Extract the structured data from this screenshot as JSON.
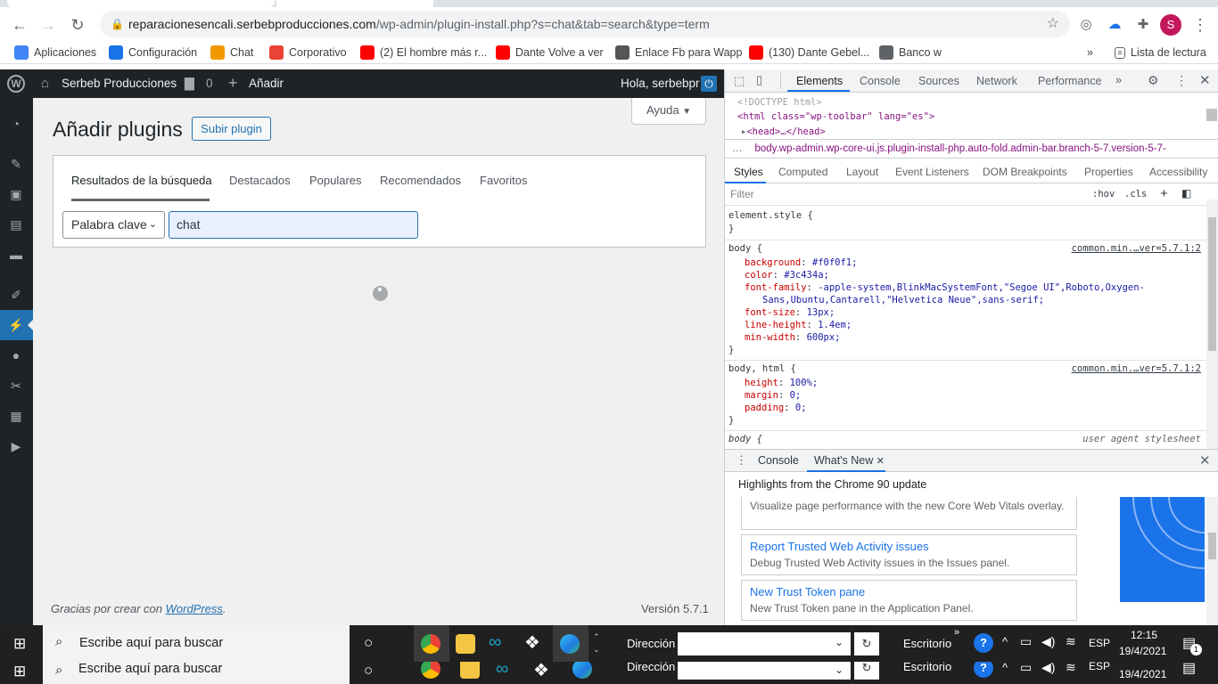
{
  "browser": {
    "url_host": "reparacionesencali.serbebproducciones.com",
    "url_path": "/wp-admin/plugin-install.php?s=chat&tab=search&type=term",
    "profile_initial": "S",
    "bookmarks": [
      {
        "label": "Aplicaciones",
        "icon": "apps-grid-icon",
        "color": "#4285f4"
      },
      {
        "label": "Configuración",
        "icon": "gear-icon",
        "color": "#1a73e8"
      },
      {
        "label": "Chat",
        "icon": "chat-icon",
        "color": "#f29900"
      },
      {
        "label": "Corporativo",
        "icon": "gmail-icon",
        "color": "#ea4335"
      },
      {
        "label": "(2) El hombre más r...",
        "icon": "youtube-icon",
        "color": "#ff0000"
      },
      {
        "label": "Dante Volve a ver",
        "icon": "youtube-icon",
        "color": "#ff0000"
      },
      {
        "label": "Enlace Fb para Wapp",
        "icon": "avatar-icon",
        "color": "#555555"
      },
      {
        "label": "(130) Dante Gebel...",
        "icon": "youtube-icon",
        "color": "#ff0000"
      },
      {
        "label": "Banco w",
        "icon": "globe-icon",
        "color": "#5f6368"
      }
    ],
    "reading_list": "Lista de lectura",
    "overflow": "»"
  },
  "wp": {
    "site_name": "Serbeb Producciones",
    "comments_count": "0",
    "add_new": "Añadir",
    "greeting": "Hola, serbebpr",
    "page_title": "Añadir plugins",
    "upload_button": "Subir plugin",
    "help_button": "Ayuda",
    "tabs": [
      "Resultados de la búsqueda",
      "Destacados",
      "Populares",
      "Recomendados",
      "Favoritos"
    ],
    "search_type": "Palabra clave",
    "search_value": "chat",
    "footer_text": "Gracias por crear con",
    "footer_link": "WordPress",
    "footer_period": ".",
    "version": "Versión 5.7.1"
  },
  "devtools": {
    "main_tabs": [
      "Elements",
      "Console",
      "Sources",
      "Network",
      "Performance"
    ],
    "dom_lines": [
      "<!DOCTYPE html>",
      "<html class=\"wp-toolbar\" lang=\"es\">",
      "<head>…</head>"
    ],
    "breadcrumb": "body.wp-admin.wp-core-ui.js.plugin-install-php.auto-fold.admin-bar.branch-5-7.version-5-7-",
    "style_tabs": [
      "Styles",
      "Computed",
      "Layout",
      "Event Listeners",
      "DOM Breakpoints",
      "Properties",
      "Accessibility"
    ],
    "filter_placeholder": "Filter",
    "hov": ":hov",
    "cls": ".cls",
    "element_style": "element.style {",
    "rule1_selector": "body {",
    "rule1_source": "common.min.…ver=5.7.1:2",
    "rule1_props": [
      {
        "p": "background",
        "v": "#f0f0f1;"
      },
      {
        "p": "color",
        "v": "#3c434a;"
      },
      {
        "p": "font-family",
        "v": "-apple-system,BlinkMacSystemFont,\"Segoe UI\",Roboto,Oxygen-"
      },
      {
        "p": "",
        "v": "Sans,Ubuntu,Cantarell,\"Helvetica Neue\",sans-serif;"
      },
      {
        "p": "font-size",
        "v": "13px;"
      },
      {
        "p": "line-height",
        "v": "1.4em;"
      },
      {
        "p": "min-width",
        "v": "600px;"
      }
    ],
    "rule2_selector": "body, html {",
    "rule2_source": "common.min.…ver=5.7.1:2",
    "rule2_props": [
      {
        "p": "height",
        "v": "100%;"
      },
      {
        "p": "margin",
        "v": "0;"
      },
      {
        "p": "padding",
        "v": "0;"
      }
    ],
    "rule3_selector": "body {",
    "rule3_source": "user agent stylesheet",
    "close_brace": "}",
    "drawer_tabs": [
      "Console",
      "What's New"
    ],
    "whats_new_title": "Highlights from the Chrome 90 update",
    "cards": [
      {
        "title": "",
        "desc": "Visualize page performance with the new Core Web Vitals overlay."
      },
      {
        "title": "Report Trusted Web Activity issues",
        "desc": "Debug Trusted Web Activity issues in the Issues panel."
      },
      {
        "title": "New Trust Token pane",
        "desc": "New Trust Token pane in the Application Panel."
      }
    ]
  },
  "taskbar": {
    "search_placeholder": "Escribe aquí para buscar",
    "address_label": "Dirección",
    "desktop_label": "Escritorio",
    "lang": "ESP",
    "time": "12:15",
    "date": "19/4/2021",
    "notif_count": "1"
  }
}
